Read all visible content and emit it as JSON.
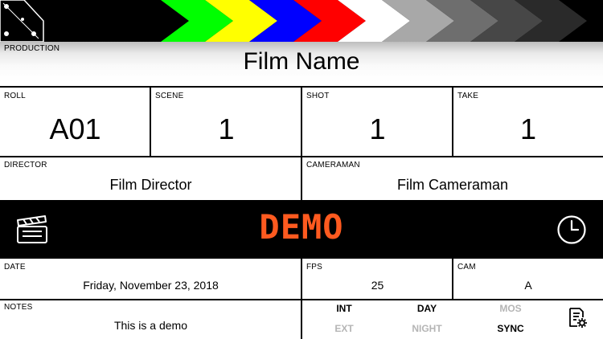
{
  "production": {
    "label": "PRODUCTION",
    "value": "Film Name"
  },
  "roll": {
    "label": "ROLL",
    "value": "A01"
  },
  "scene": {
    "label": "SCENE",
    "value": "1"
  },
  "shot": {
    "label": "SHOT",
    "value": "1"
  },
  "take": {
    "label": "TAKE",
    "value": "1"
  },
  "director": {
    "label": "DIRECTOR",
    "value": "Film Director"
  },
  "cameraman": {
    "label": "CAMERAMAN",
    "value": "Film Cameraman"
  },
  "banner": {
    "text": "DEMO",
    "color": "#ff5a1f"
  },
  "date": {
    "label": "DATE",
    "value": "Friday, November 23, 2018"
  },
  "fps": {
    "label": "FPS",
    "value": "25"
  },
  "cam": {
    "label": "CAM",
    "value": "A"
  },
  "notes": {
    "label": "NOTES",
    "value": "This is a demo"
  },
  "toggles": {
    "int": {
      "label": "INT",
      "active": true
    },
    "day": {
      "label": "DAY",
      "active": true
    },
    "mos": {
      "label": "MOS",
      "active": false
    },
    "ext": {
      "label": "EXT",
      "active": false
    },
    "night": {
      "label": "NIGHT",
      "active": false
    },
    "sync": {
      "label": "SYNC",
      "active": true
    }
  },
  "colors": {
    "clapper_stripes": [
      "#00ff00",
      "#ffff00",
      "#0000ff",
      "#ff0000",
      "#ffffff",
      "#a8a8a8",
      "#6e6e6e",
      "#474747",
      "#2a2a2a"
    ],
    "active_toggle": "#000000",
    "inactive_toggle": "#b5b5b5"
  },
  "icons": {
    "clapper": "clapperboard-icon",
    "clock": "clock-icon",
    "settings": "document-gear-icon",
    "hinge": "clapper-hinge-icon"
  }
}
